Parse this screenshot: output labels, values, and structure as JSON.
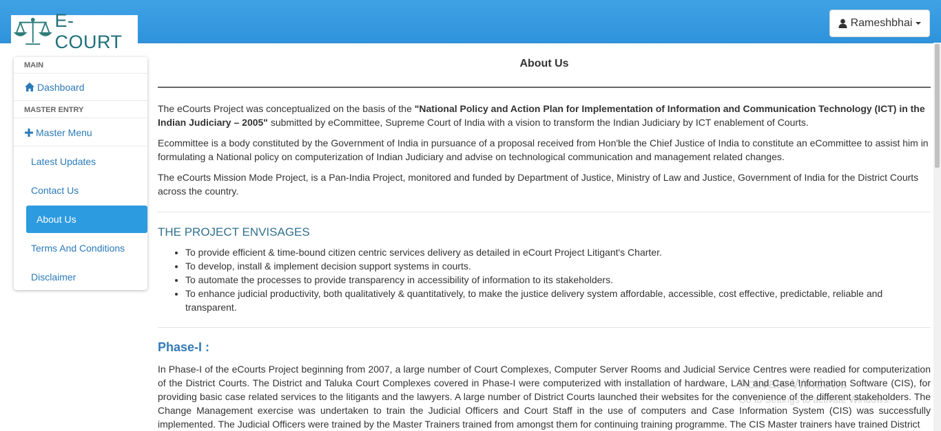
{
  "header": {
    "logo_text": "E-COURT",
    "user_name": "Rameshbhai"
  },
  "sidebar": {
    "section_main": "MAIN",
    "dashboard": "Dashboard",
    "section_master": "MASTER ENTRY",
    "master_menu": "Master Menu",
    "sub_items": [
      "Latest Updates",
      "Contact Us",
      "About Us",
      "Terms And Conditions",
      "Disclaimer"
    ]
  },
  "content": {
    "title": "About Us",
    "p1_start": "The eCourts Project was conceptualized on the basis of the ",
    "p1_bold": "\"National Policy and Action Plan for Implementation of Information and Communication Technology (ICT) in the Indian Judiciary – 2005\"",
    "p1_end": " submitted by eCommittee, Supreme Court of India with a vision to transform the Indian Judiciary by ICT enablement of Courts.",
    "p2": "Ecommittee is a body constituted by the Government of India in pursuance of a proposal received from Hon'ble the Chief Justice of India to constitute an eCommittee to assist him in formulating a National policy on computerization of Indian Judiciary and advise on technological communication and management related changes.",
    "p3": "The eCourts Mission Mode Project, is a Pan-India Project, monitored and funded by Department of Justice, Ministry of Law and Justice, Government of India for the District Courts across the country.",
    "envisages_title": "THE PROJECT ENVISAGES",
    "envisages": [
      "To provide efficient & time-bound citizen centric services delivery as detailed in eCourt Project Litigant's Charter.",
      "To develop, install & implement decision support systems in courts.",
      "To automate the processes to provide transparency in accessibility of information to its stakeholders.",
      "To enhance judicial productivity, both qualitatively & quantitatively, to make the justice delivery system affordable, accessible, cost effective, predictable, reliable and transparent."
    ],
    "phase1_title": "Phase-I :",
    "phase1_text": "In Phase-I of the eCourts Project beginning from 2007, a large number of Court Complexes, Computer Server Rooms and Judicial Service Centres were readied for computerization of the District Courts. The District and Taluka Court Complexes covered in Phase-I were computerized with installation of hardware, LAN and Case Information Software (CIS), for providing basic case related services to the litigants and the lawyers. A large number of District Courts launched their websites for the convenience of the different stakeholders. The Change Management exercise was undertaken to train the Judicial Officers and Court Staff in the use of computers and Case Information System (CIS) was successfully implemented. The Judicial Officers were trained by the Master Trainers trained from amongst them for continuing training programme. The CIS Master trainers have trained District"
  },
  "watermark": {
    "line1": "Activate Windows",
    "line2": "Go to Settings to activate Windows."
  }
}
